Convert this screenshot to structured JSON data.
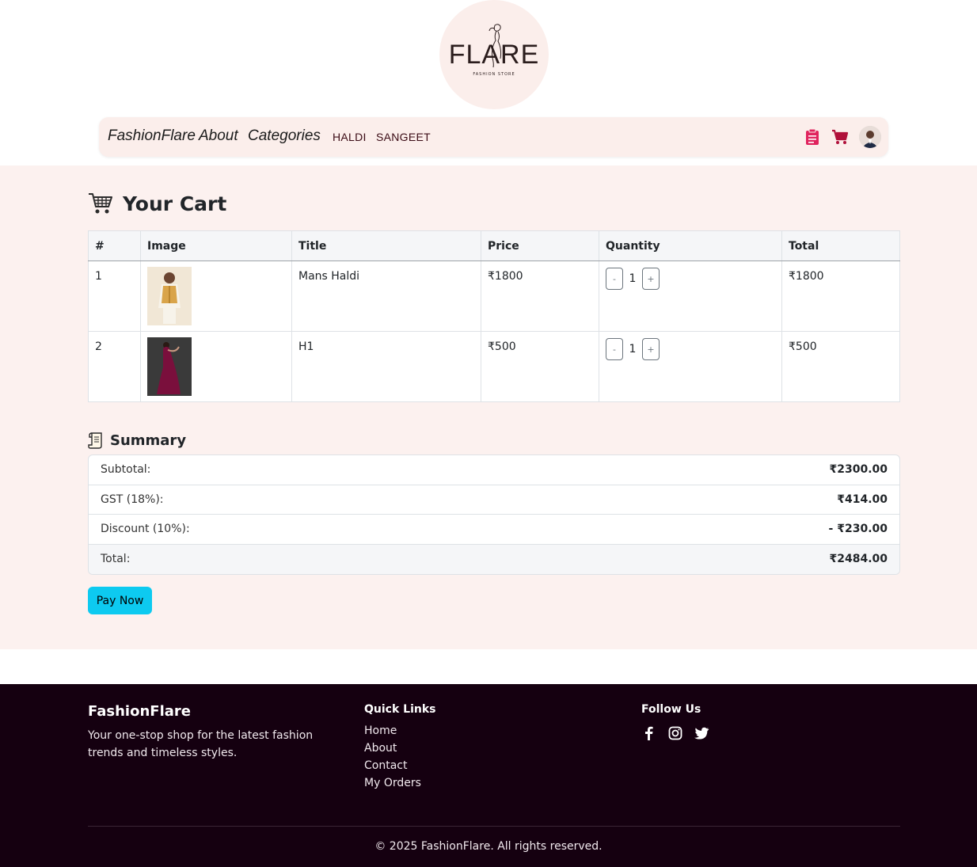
{
  "logo": {
    "text": "FLARE",
    "subtext": "FASHION STORE"
  },
  "navbar": {
    "brand": "FashionFlare",
    "about": "About",
    "categories": "Categories",
    "links": [
      "HALDI",
      "SANGEET"
    ],
    "icons": [
      "orders-icon",
      "cart-icon",
      "avatar"
    ],
    "colors": {
      "icon": "#c2185b",
      "bg": "#fbeeeb"
    }
  },
  "cart": {
    "title": "Your Cart",
    "columns": [
      "#",
      "Image",
      "Title",
      "Price",
      "Quantity",
      "Total"
    ],
    "rows": [
      {
        "index": "1",
        "title": "Mans Haldi",
        "price": "₹1800",
        "quantity": "1",
        "total": "₹1800",
        "image": "mans-haldi-thumbnail"
      },
      {
        "index": "2",
        "title": "H1",
        "price": "₹500",
        "quantity": "1",
        "total": "₹500",
        "image": "h1-thumbnail"
      }
    ],
    "minus": "-",
    "plus": "+"
  },
  "summary": {
    "title": "Summary",
    "rows": [
      {
        "label": "Subtotal:",
        "value": "₹2300.00"
      },
      {
        "label": "GST (18%):",
        "value": "₹414.00"
      },
      {
        "label": "Discount (10%):",
        "value": "- ₹230.00"
      },
      {
        "label": "Total:",
        "value": "₹2484.00"
      }
    ]
  },
  "pay_button": "Pay Now",
  "footer": {
    "brand": "FashionFlare",
    "description": "Your one-stop shop for the latest fashion trends and timeless styles.",
    "quick_links_title": "Quick Links",
    "quick_links": [
      "Home",
      "About",
      "Contact",
      "My Orders"
    ],
    "follow_title": "Follow Us",
    "social": [
      "facebook-icon",
      "instagram-icon",
      "twitter-icon"
    ],
    "copyright": "© 2025 FashionFlare. All rights reserved."
  },
  "colors": {
    "page_bg": "#fcf1ef",
    "footer_bg": "#150010",
    "pay_button": "#0dcaf0"
  }
}
